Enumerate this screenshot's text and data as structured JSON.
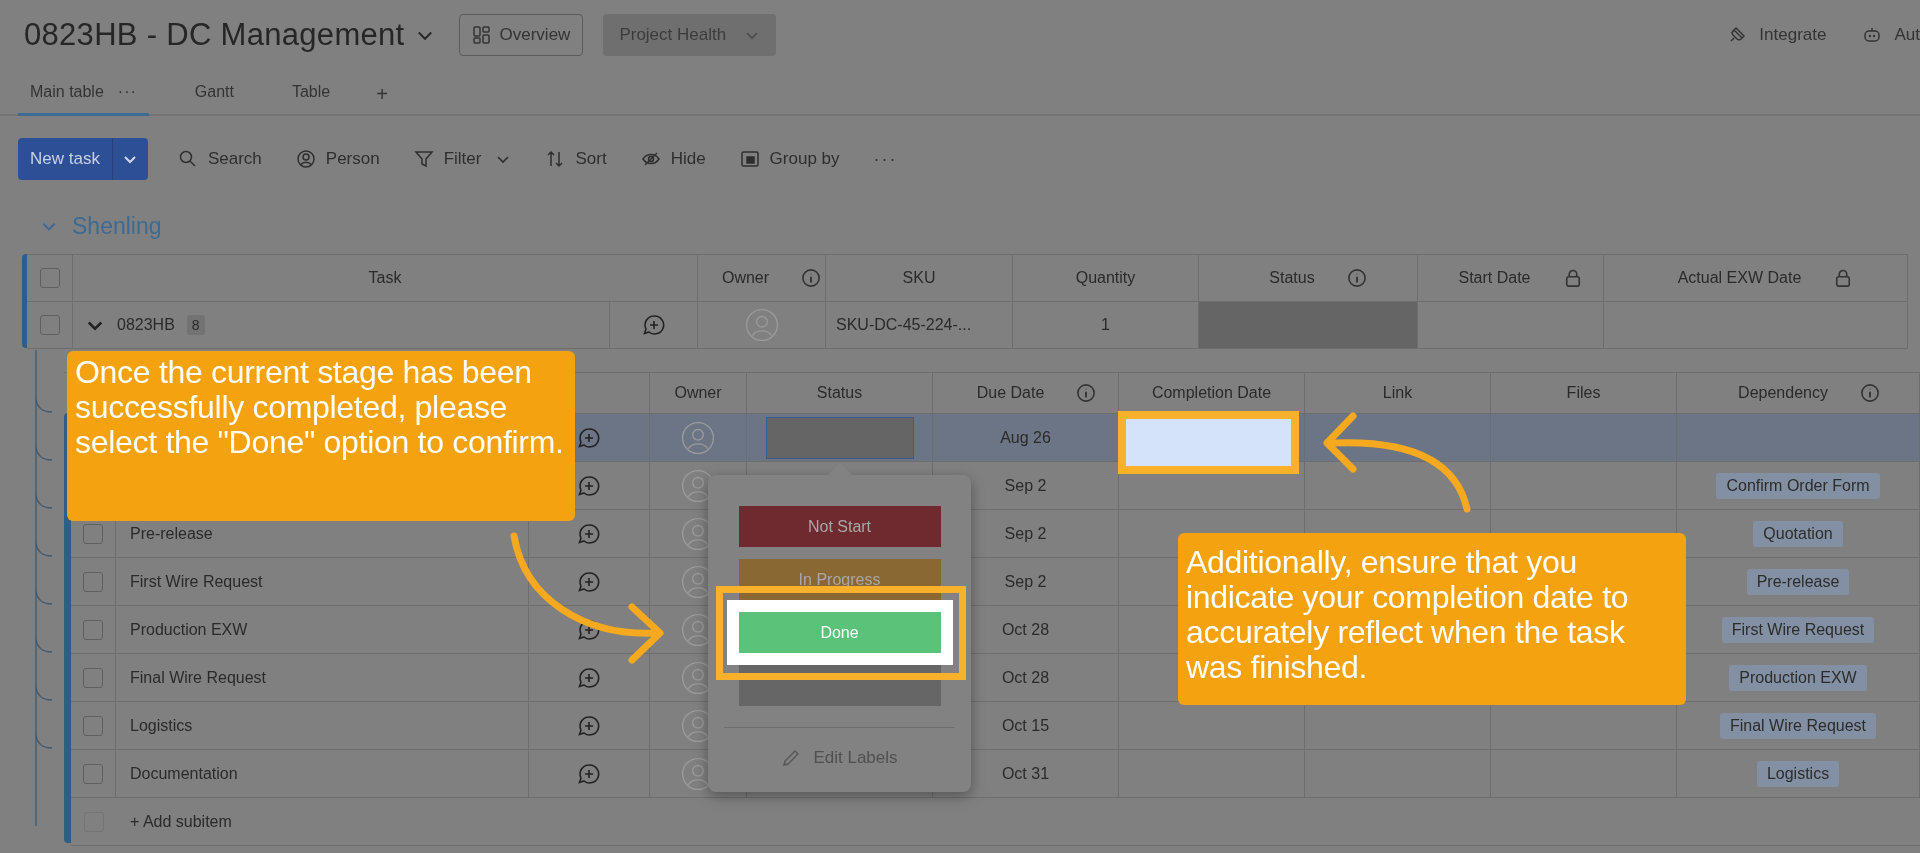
{
  "header": {
    "title": "0823HB - DC Management",
    "overview": "Overview",
    "project_health": "Project Health",
    "integrate": "Integrate",
    "automate": "Aut"
  },
  "view_tabs": [
    {
      "label": "Main table",
      "selected": true,
      "menu": "···"
    },
    {
      "label": "Gantt",
      "selected": false
    },
    {
      "label": "Table",
      "selected": false
    }
  ],
  "add_view": "+",
  "toolbar": {
    "new_task": "New task",
    "items": [
      {
        "label": "Search",
        "kind": "search",
        "dropdown": false
      },
      {
        "label": "Person",
        "kind": "person",
        "dropdown": false
      },
      {
        "label": "Filter",
        "kind": "filter",
        "dropdown": true
      },
      {
        "label": "Sort",
        "kind": "sort",
        "dropdown": false
      },
      {
        "label": "Hide",
        "kind": "hide",
        "dropdown": false
      },
      {
        "label": "Group by",
        "kind": "group",
        "dropdown": false
      }
    ],
    "more": "···"
  },
  "group": {
    "name": "Shenling",
    "expanded": true
  },
  "table": {
    "all_checked": false,
    "columns": [
      {
        "label": "Task"
      },
      {
        "label": "Owner"
      },
      {
        "label": "SKU"
      },
      {
        "label": "Quantity"
      },
      {
        "label": "Status"
      },
      {
        "label": "Start Date"
      },
      {
        "label": "Actual EXW Date"
      }
    ],
    "rows": [
      {
        "task": "0823HB",
        "count": "8",
        "sku": "SKU-DC-45-224-...",
        "quantity": "1",
        "expanded": true,
        "checked": false
      }
    ]
  },
  "subtable": {
    "columns": [
      {
        "label": "Owner"
      },
      {
        "label": "Status"
      },
      {
        "label": "Due Date"
      },
      {
        "label": "Completion Date"
      },
      {
        "label": "Link"
      },
      {
        "label": "Files"
      },
      {
        "label": "Dependency"
      }
    ],
    "rows": [
      {
        "due": "Aug 26",
        "selected": true
      },
      {
        "due": "Sep 2",
        "dependency": "Confirm Order Form",
        "selected": false
      },
      {
        "name": "Pre-release",
        "due": "Sep 2",
        "dependency": "Quotation",
        "selected": false,
        "checked": false
      },
      {
        "name": "First Wire Request",
        "due": "Sep 2",
        "dependency": "Pre-release",
        "selected": false,
        "checked": false
      },
      {
        "name": "Production EXW",
        "due": "Oct 28",
        "dependency": "First Wire Request",
        "selected": false,
        "checked": false
      },
      {
        "name": "Final Wire Request",
        "due": "Oct 28",
        "dependency": "Production EXW",
        "selected": false,
        "checked": false
      },
      {
        "name": "Logistics",
        "due": "Oct 15",
        "dependency": "Final Wire Request",
        "selected": false,
        "checked": false
      },
      {
        "name": "Documentation",
        "due": "Oct 31",
        "dependency": "Logistics",
        "selected": false,
        "checked": false
      }
    ],
    "add": "+ Add subitem"
  },
  "status_menu": {
    "options": [
      {
        "label": "Not Start",
        "color": "#6e2a2e",
        "highlighted": false
      },
      {
        "label": "In Progress",
        "color": "#8a6834",
        "highlighted": false
      },
      {
        "label": "Done",
        "color": "#5bc27a",
        "highlighted": true
      },
      {
        "color": "#666666",
        "highlighted": false
      }
    ],
    "edit": "Edit Labels"
  },
  "callouts": [
    {
      "text": "Once the current stage has been successfully completed, please select the \"Done\" option to confirm."
    },
    {
      "text": "Additionally, ensure that you indicate your completion date to accurately reflect when the task was finished."
    }
  ]
}
